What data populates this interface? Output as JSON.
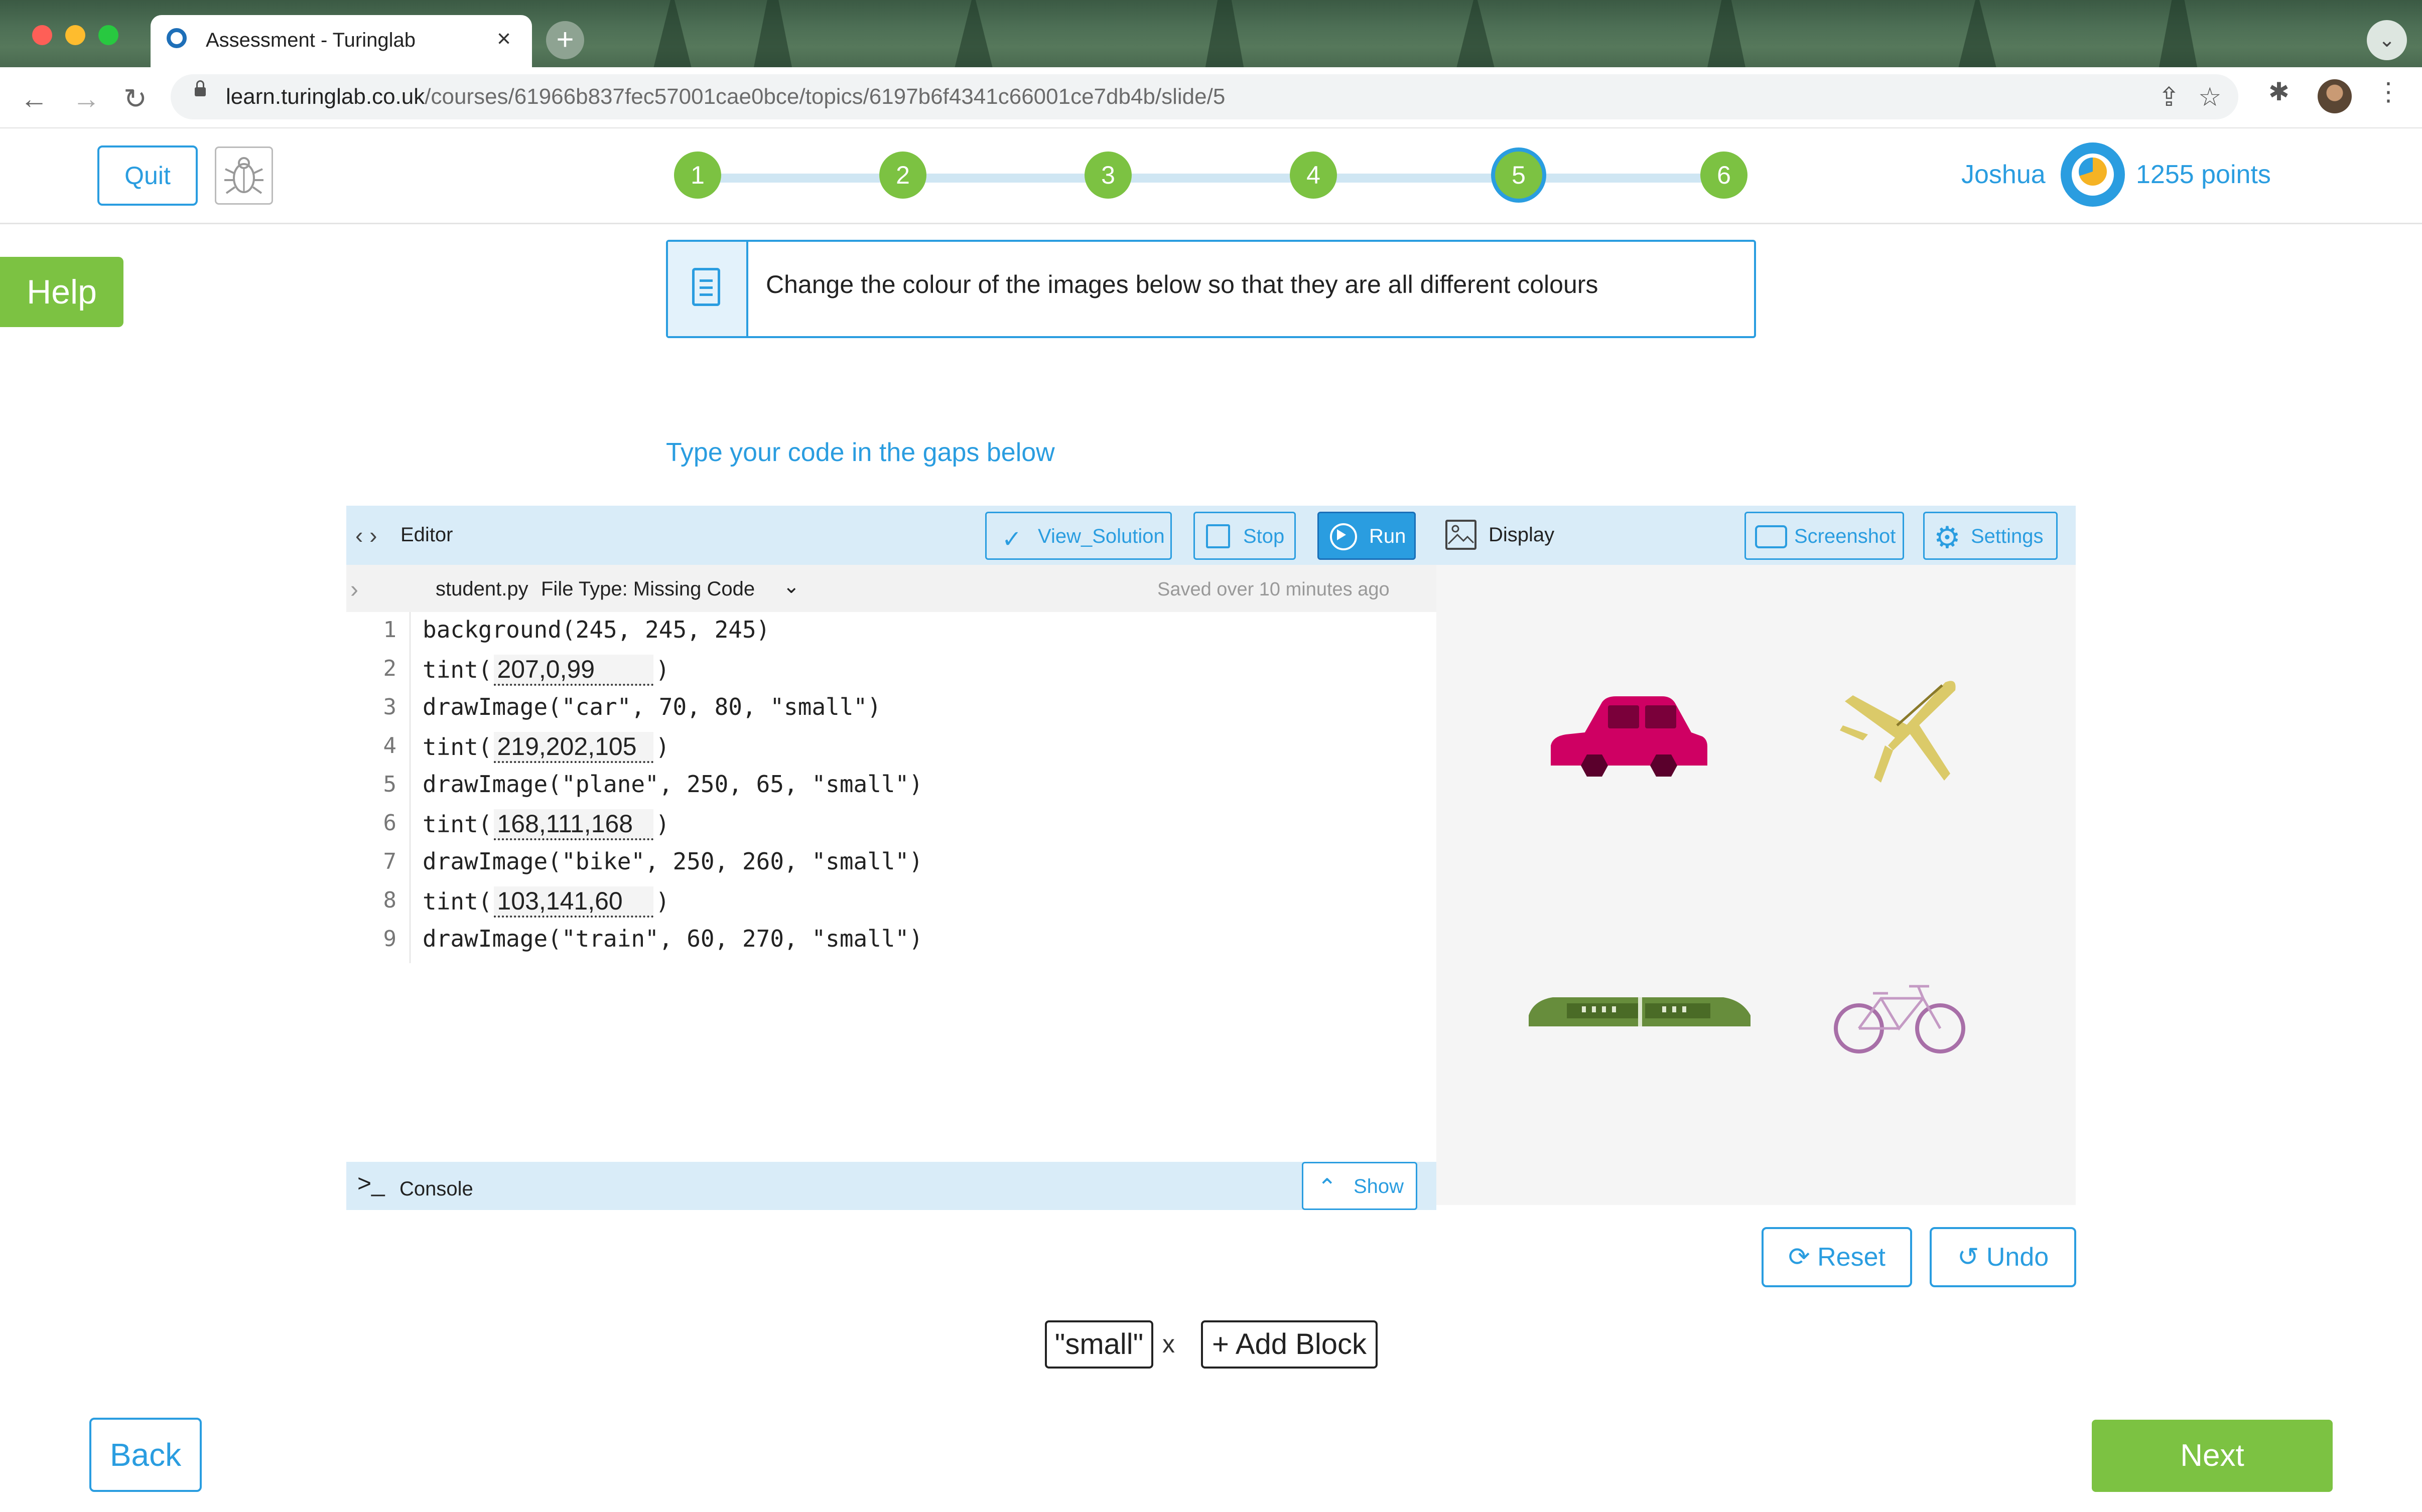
{
  "browser": {
    "tab_title": "Assessment - Turinglab",
    "tab_close": "×",
    "new_tab": "+",
    "tab_menu": "⌄",
    "url_host": "learn.turinglab.co.uk",
    "url_path": "/courses/61966b837fec57001cae0bce/topics/6197b6f4341c66001ce7db4b/slide/5"
  },
  "header": {
    "quit_label": "Quit",
    "steps": [
      "1",
      "2",
      "3",
      "4",
      "5",
      "6"
    ],
    "current_step": 5,
    "username": "Joshua",
    "points": "1255 points"
  },
  "help_label": "Help",
  "instruction": "Change the colour of the images below so that they are all different colours",
  "gaps_hint": "Type your code in the gaps below",
  "editor": {
    "title": "Editor",
    "view_solution": "View_Solution",
    "stop": "Stop",
    "run": "Run",
    "file_name": "student.py",
    "file_type": "File Type: Missing Code",
    "saved_status": "Saved over 10 minutes ago",
    "lines": [
      {
        "n": "1",
        "pre": "background(245, 245, 245)"
      },
      {
        "n": "2",
        "pre": "tint(",
        "gap": "207,0,99",
        "post": ")"
      },
      {
        "n": "3",
        "pre": "drawImage(\"car\", 70, 80, \"small\")"
      },
      {
        "n": "4",
        "pre": "tint(",
        "gap": "219,202,105",
        "post": ")"
      },
      {
        "n": "5",
        "pre": "drawImage(\"plane\", 250, 65, \"small\")"
      },
      {
        "n": "6",
        "pre": "tint(",
        "gap": "168,111,168",
        "post": ")"
      },
      {
        "n": "7",
        "pre": "drawImage(\"bike\", 250, 260, \"small\")"
      },
      {
        "n": "8",
        "pre": "tint(",
        "gap": "103,141,60",
        "post": ")"
      },
      {
        "n": "9",
        "pre": "drawImage(\"train\", 60, 270, \"small\")"
      }
    ]
  },
  "display": {
    "title": "Display",
    "screenshot": "Screenshot",
    "settings": "Settings",
    "colors": {
      "car": "#cf0063",
      "plane": "#dbca69",
      "bike": "#a86fa8",
      "train": "#678d3c"
    }
  },
  "console": {
    "title": "Console",
    "show": "Show"
  },
  "actions": {
    "reset": "Reset",
    "undo": "Undo"
  },
  "blocks": {
    "items": [
      "\"small\""
    ],
    "remove": "x",
    "add": "+ Add Block"
  },
  "nav": {
    "back": "Back",
    "next": "Next"
  },
  "theme": {
    "accent": "#2a9de0",
    "success": "#7cc242"
  }
}
